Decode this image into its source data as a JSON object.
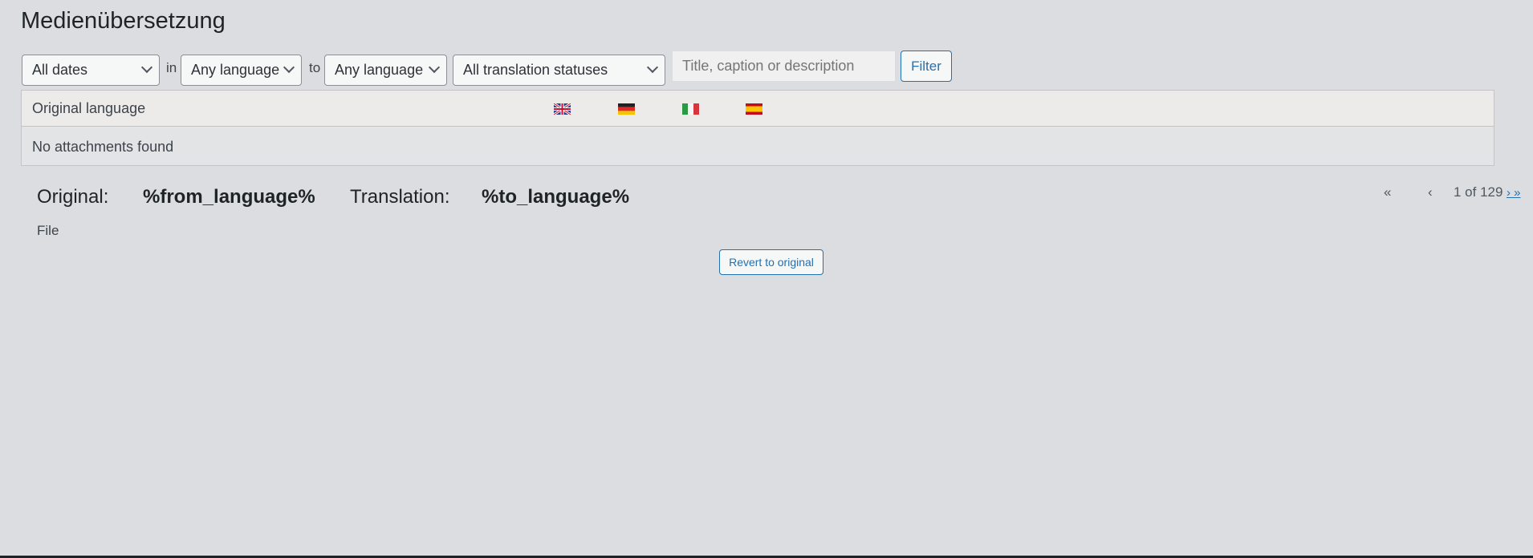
{
  "title": "Medienübersetzung",
  "filters": {
    "dates": "All dates",
    "in": "in",
    "from_lang": "Any language",
    "to": "to",
    "to_lang": "Any language",
    "status": "All translation statuses",
    "search_placeholder": "Title, caption or description",
    "filter_label": "Filter"
  },
  "table": {
    "header": "Original language",
    "flags": [
      "gb-flag",
      "de-flag",
      "it-flag",
      "es-flag"
    ],
    "empty": "No attachments found"
  },
  "detail": {
    "original_label": "Original:",
    "from": "%from_language%",
    "translation_label": "Translation:",
    "to": "%to_language%",
    "file_label": "File",
    "revert_label": "Revert to original"
  },
  "pagination": {
    "first": "«",
    "prev": "‹",
    "info": "1 of 129",
    "next_last": "› »"
  }
}
